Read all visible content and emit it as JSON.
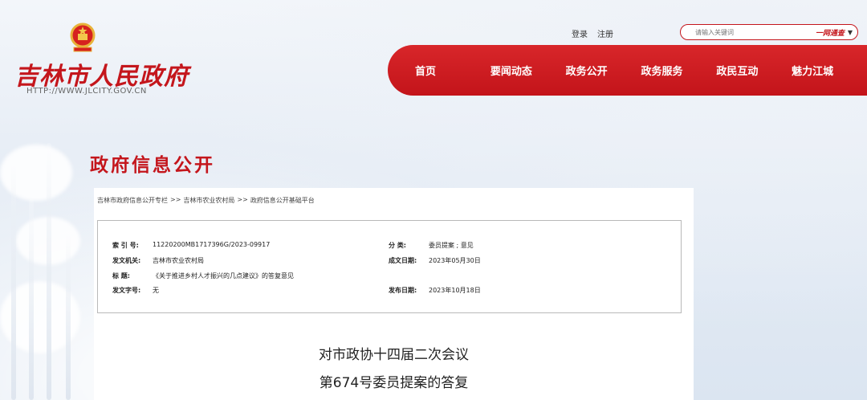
{
  "site": {
    "logo_text": "吉林市人民政府",
    "url_text": "HTTP://WWW.JLCITY.GOV.CN"
  },
  "auth": {
    "login": "登录",
    "register": "注册"
  },
  "search": {
    "placeholder": "请输入关键词",
    "scope": "一网通查"
  },
  "nav": {
    "items": [
      "首页",
      "要闻动态",
      "政务公开",
      "政务服务",
      "政民互动",
      "魅力江城"
    ]
  },
  "page_title": "政府信息公开",
  "breadcrumb": {
    "items": [
      "吉林市政府信息公开专栏",
      "吉林市农业农村局",
      "政府信息公开基础平台"
    ],
    "separator": ">>"
  },
  "meta": {
    "index_label": "索 引 号:",
    "index_value": "11220200MB1717396G/2023-09917",
    "category_label": "分 类:",
    "category_value": "委员提案 ; 意见",
    "issuer_label": "发文机关:",
    "issuer_value": "吉林市农业农村局",
    "date_created_label": "成文日期:",
    "date_created_value": "2023年05月30日",
    "title_label": "标 题:",
    "title_value": "《关于推进乡村人才振兴的几点建议》的答复意见",
    "doc_number_label": "发文字号:",
    "doc_number_value": "无",
    "publish_date_label": "发布日期:",
    "publish_date_value": "2023年10月18日"
  },
  "document": {
    "title_line1": "对市政协十四届二次会议",
    "title_line2": "第674号委员提案的答复"
  },
  "colors": {
    "brand_red": "#c4161c"
  }
}
